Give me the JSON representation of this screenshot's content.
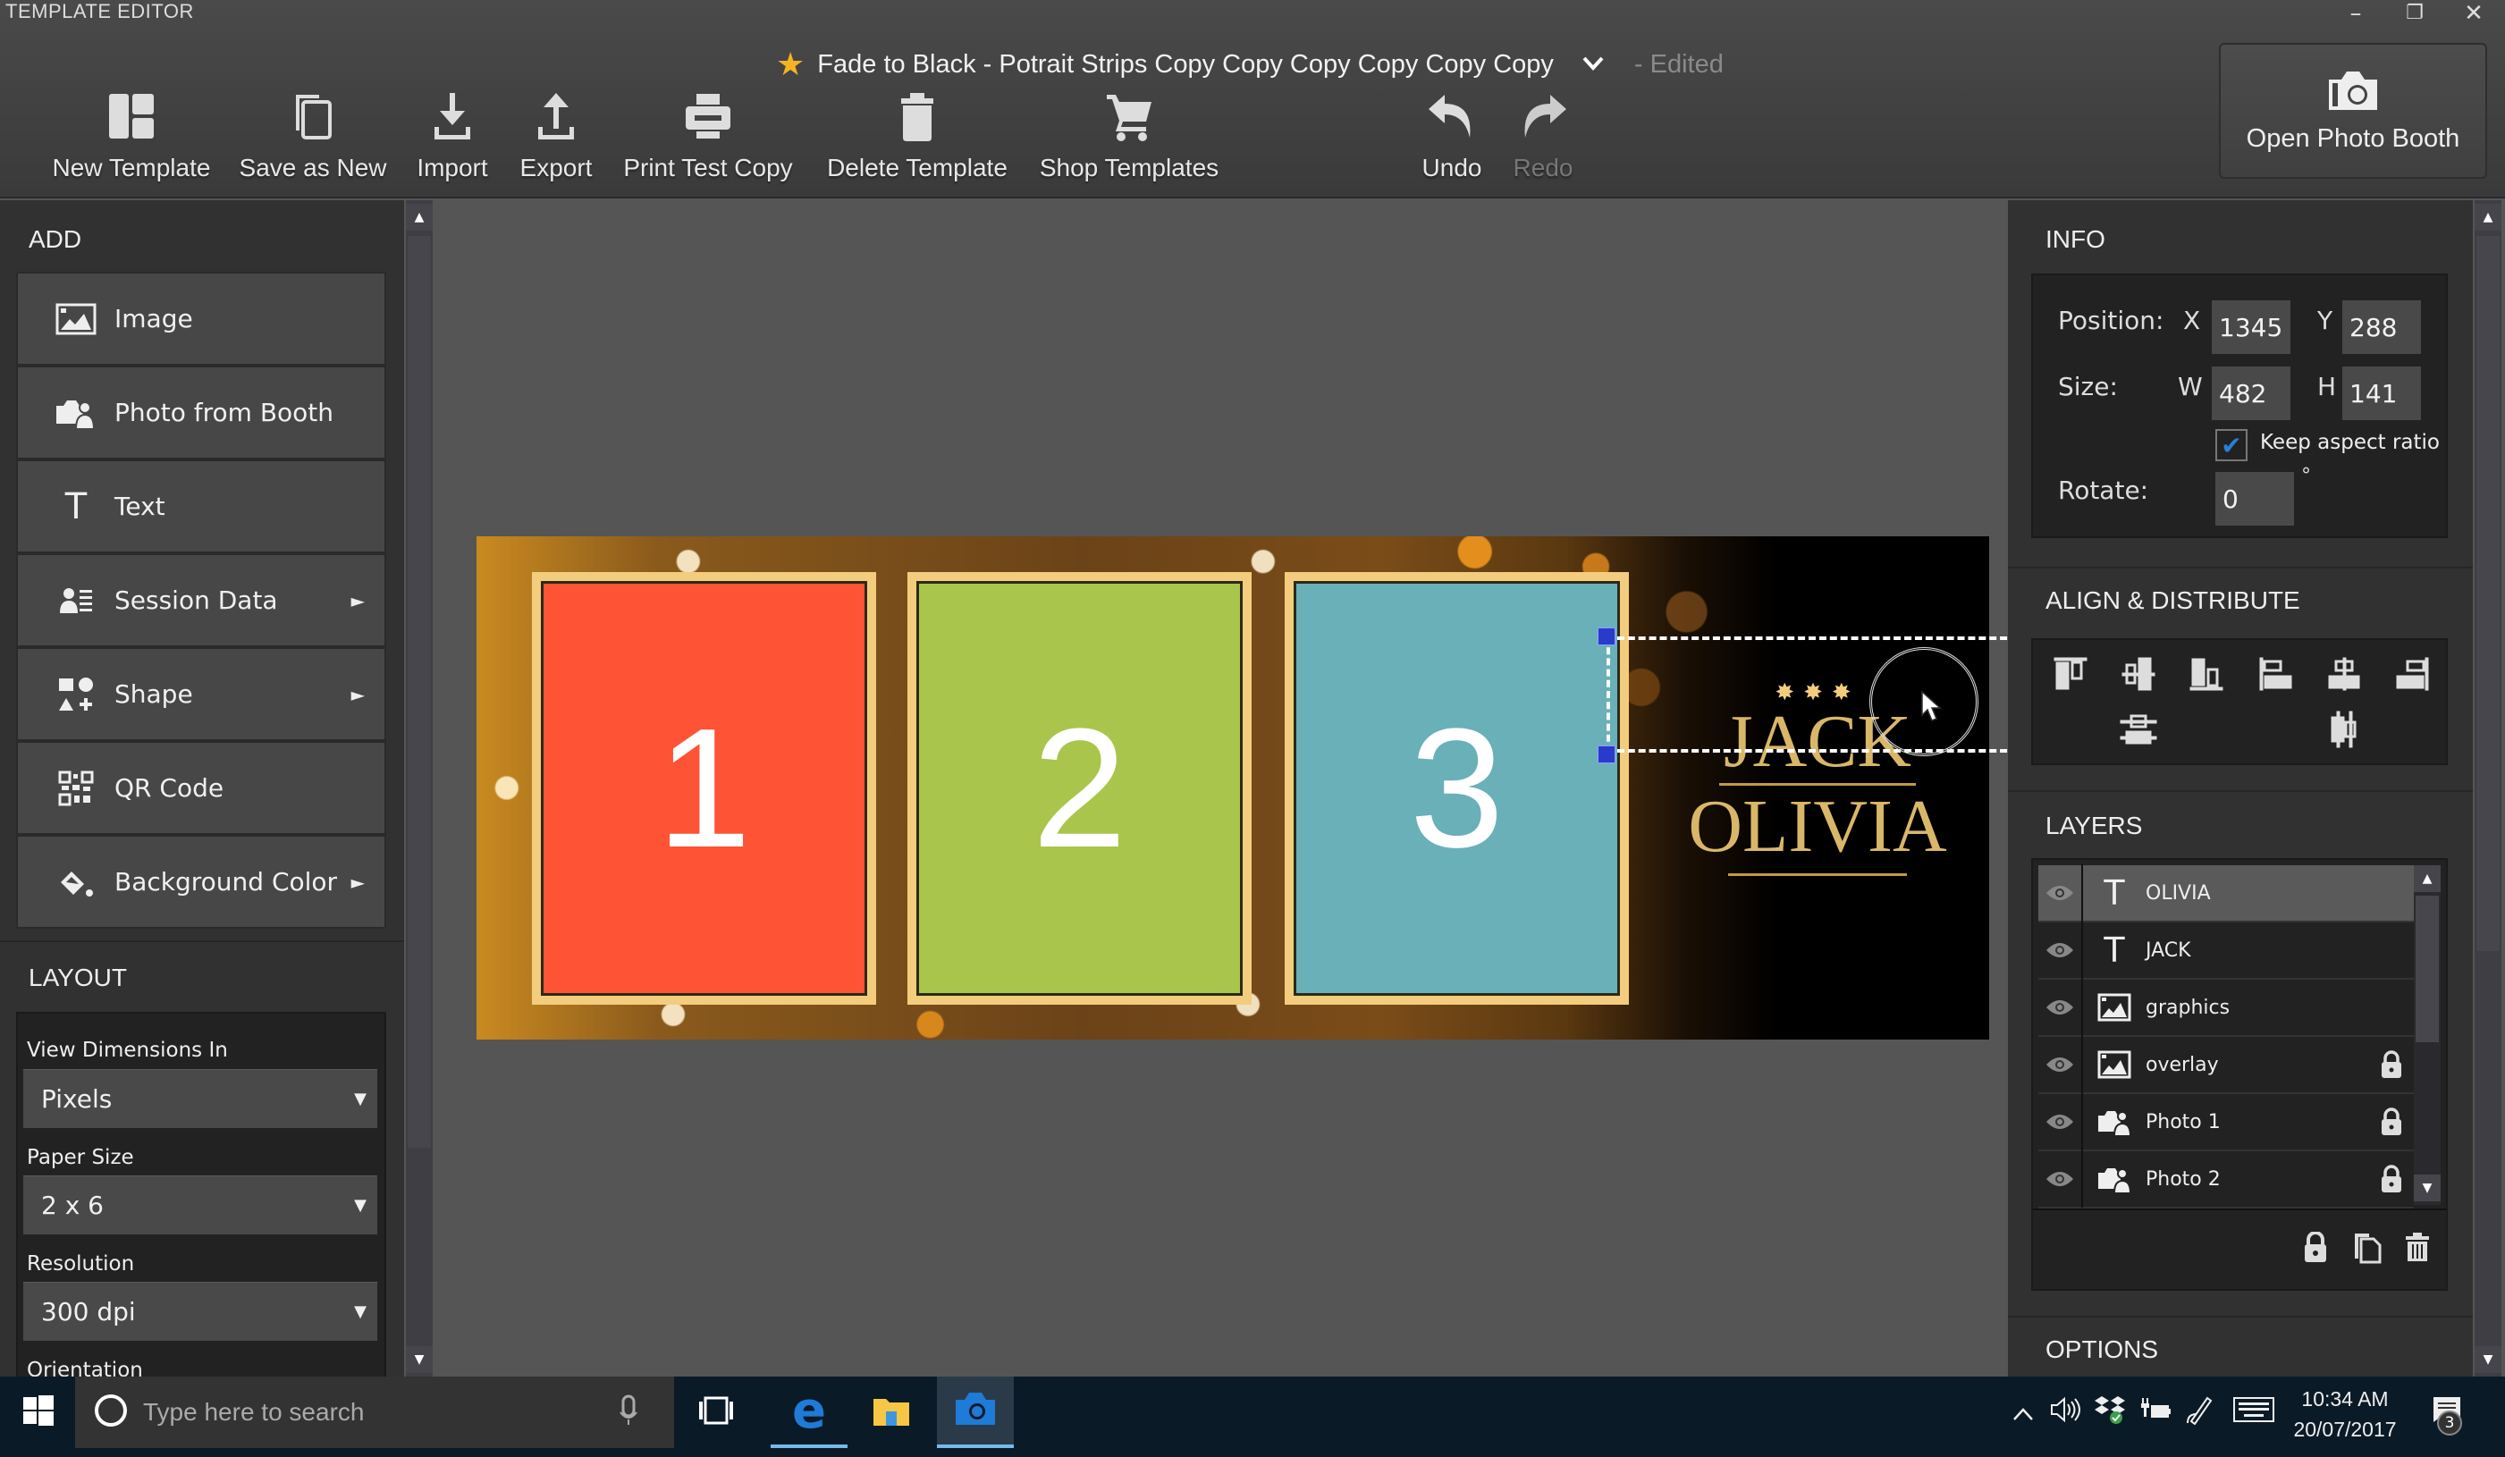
{
  "window": {
    "app_title": "TEMPLATE EDITOR",
    "minimize": "–",
    "restore": "❐",
    "close": "✕"
  },
  "document": {
    "title": "Fade to Black - Potrait Strips Copy Copy Copy Copy Copy Copy",
    "favorite_icon": "star-icon",
    "status": "- Edited"
  },
  "toolbar": {
    "buttons": [
      {
        "label": "New Template",
        "icon": "new-template-icon",
        "enabled": true
      },
      {
        "label": "Save as New",
        "icon": "copy-icon",
        "enabled": true
      },
      {
        "label": "Import",
        "icon": "download-icon",
        "enabled": true
      },
      {
        "label": "Export",
        "icon": "upload-icon",
        "enabled": true
      },
      {
        "label": "Print Test Copy",
        "icon": "printer-icon",
        "enabled": true
      },
      {
        "label": "Delete Template",
        "icon": "trash-icon",
        "enabled": true
      },
      {
        "label": "Shop Templates",
        "icon": "cart-icon",
        "enabled": true
      },
      {
        "label": "Undo",
        "icon": "undo-icon",
        "enabled": true
      },
      {
        "label": "Redo",
        "icon": "redo-icon",
        "enabled": false
      }
    ],
    "open_photo_booth": "Open Photo Booth"
  },
  "left_panel": {
    "add_title": "ADD",
    "add_items": [
      {
        "label": "Image",
        "icon": "image-icon",
        "submenu": false
      },
      {
        "label": "Photo from Booth",
        "icon": "photo-booth-icon",
        "submenu": false
      },
      {
        "label": "Text",
        "icon": "text-icon",
        "submenu": false
      },
      {
        "label": "Session Data",
        "icon": "session-data-icon",
        "submenu": true
      },
      {
        "label": "Shape",
        "icon": "shape-icon",
        "submenu": true
      },
      {
        "label": "QR Code",
        "icon": "qr-code-icon",
        "submenu": false
      },
      {
        "label": "Background Color",
        "icon": "paint-bucket-icon",
        "submenu": true
      }
    ],
    "submenu_arrow": "►",
    "layout_title": "LAYOUT",
    "layout": {
      "view_dimensions_label": "View Dimensions In",
      "view_dimensions_value": "Pixels",
      "paper_size_label": "Paper Size",
      "paper_size_value": "2 x 6",
      "resolution_label": "Resolution",
      "resolution_value": "300 dpi",
      "orientation_label": "Orientation"
    },
    "caret": "▼"
  },
  "canvas": {
    "photo_slots": [
      {
        "number": "1",
        "color": "#fe5335"
      },
      {
        "number": "2",
        "color": "#a9c54b"
      },
      {
        "number": "3",
        "color": "#6ab0b8"
      }
    ],
    "decoration_stars": "✸✸✸",
    "text_jack": "JACK",
    "text_olivia": "OLIVIA",
    "text_color": "#d9b769",
    "selection_handle_color": "#2a3acb"
  },
  "right_panel": {
    "info_title": "INFO",
    "position_label": "Position:",
    "x_label": "X",
    "x_value": "1345",
    "y_label": "Y",
    "y_value": "288",
    "size_label": "Size:",
    "w_label": "W",
    "w_value": "482",
    "h_label": "H",
    "h_value": "141",
    "keep_aspect_label": "Keep aspect ratio",
    "keep_aspect_checked": true,
    "check_mark": "✔",
    "rotate_label": "Rotate:",
    "rotate_value": "0",
    "degree_symbol": "°",
    "align_title": "ALIGN & DISTRIBUTE",
    "align_buttons": [
      "align-top",
      "align-vertical-center",
      "align-bottom",
      "align-left",
      "align-horizontal-center",
      "align-right",
      "distribute-vertical",
      "distribute-horizontal"
    ],
    "layers_title": "LAYERS",
    "layers": [
      {
        "name": "OLIVIA",
        "type": "text",
        "locked": false,
        "selected": true,
        "visible": true
      },
      {
        "name": "JACK",
        "type": "text",
        "locked": false,
        "selected": false,
        "visible": true
      },
      {
        "name": "graphics",
        "type": "image",
        "locked": false,
        "selected": false,
        "visible": true
      },
      {
        "name": "overlay",
        "type": "image",
        "locked": true,
        "selected": false,
        "visible": true
      },
      {
        "name": "Photo 1",
        "type": "photo",
        "locked": true,
        "selected": false,
        "visible": true
      },
      {
        "name": "Photo 2",
        "type": "photo",
        "locked": true,
        "selected": false,
        "visible": true
      }
    ],
    "options_title": "OPTIONS"
  },
  "taskbar": {
    "search_placeholder": "Type here to search",
    "time": "10:34 AM",
    "date": "20/07/2017",
    "notification_count": "3",
    "pinned": [
      "task-view",
      "edge",
      "file-explorer",
      "photo-booth-app"
    ],
    "active_app": "photo-booth-app"
  }
}
